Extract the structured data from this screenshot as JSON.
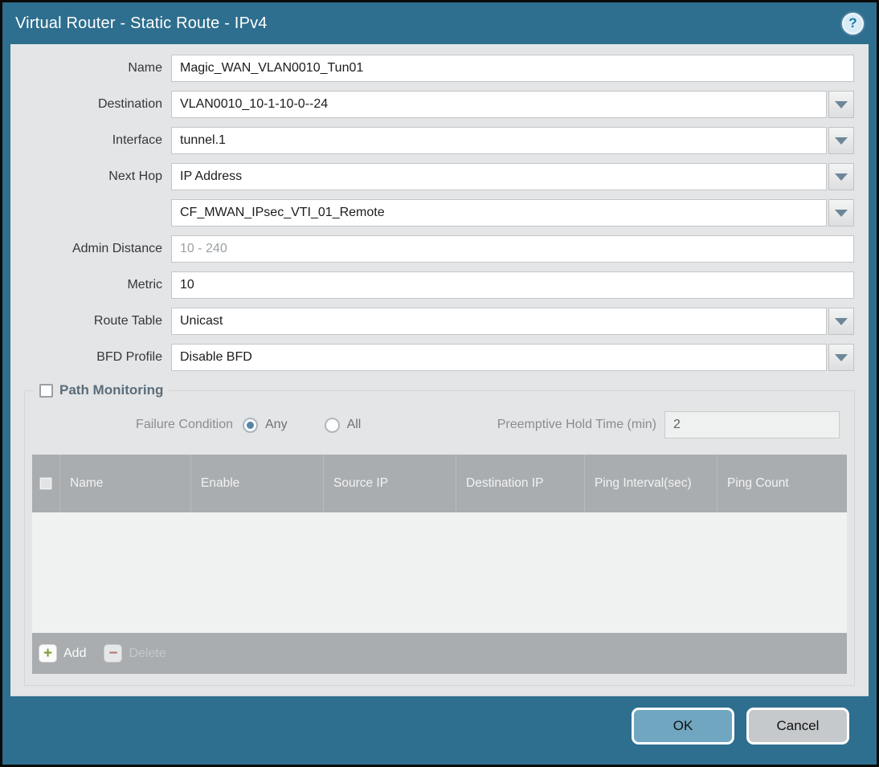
{
  "dialog": {
    "title": "Virtual Router - Static Route - IPv4",
    "help_glyph": "?"
  },
  "form": {
    "fields": [
      {
        "label": "Name",
        "value": "Magic_WAN_VLAN0010_Tun01",
        "type": "text"
      },
      {
        "label": "Destination",
        "value": "VLAN0010_10-1-10-0--24",
        "type": "dropdown"
      },
      {
        "label": "Interface",
        "value": "tunnel.1",
        "type": "dropdown"
      },
      {
        "label": "Next Hop",
        "value": "IP Address",
        "type": "dropdown"
      },
      {
        "label": "",
        "value": "CF_MWAN_IPsec_VTI_01_Remote",
        "type": "dropdown"
      },
      {
        "label": "Admin Distance",
        "value": "",
        "placeholder": "10 - 240",
        "type": "text"
      },
      {
        "label": "Metric",
        "value": "10",
        "type": "text"
      },
      {
        "label": "Route Table",
        "value": "Unicast",
        "type": "dropdown"
      },
      {
        "label": "BFD Profile",
        "value": "Disable BFD",
        "type": "dropdown"
      }
    ]
  },
  "path_monitoring": {
    "legend": "Path Monitoring",
    "enabled": false,
    "failure_condition": {
      "label": "Failure Condition",
      "options": [
        {
          "label": "Any",
          "selected": true
        },
        {
          "label": "All",
          "selected": false
        }
      ]
    },
    "preemptive_hold_time": {
      "label": "Preemptive Hold Time (min)",
      "value": "2"
    },
    "table": {
      "columns": [
        "Name",
        "Enable",
        "Source IP",
        "Destination IP",
        "Ping Interval(sec)",
        "Ping Count"
      ],
      "rows": []
    },
    "actions": {
      "add": "Add",
      "delete": "Delete",
      "delete_disabled": true
    }
  },
  "footer": {
    "ok": "OK",
    "cancel": "Cancel"
  },
  "colors": {
    "frame_teal": "#2e6e8e",
    "content_bg": "#e4e5e6",
    "table_header_bg": "#a9adb0",
    "ok_button_bg": "#71a6c1",
    "cancel_button_bg": "#c6c9cb",
    "add_icon_green": "#7d9c3c",
    "delete_icon_red": "#b0685c",
    "radio_dot_blue": "#5886a6"
  }
}
